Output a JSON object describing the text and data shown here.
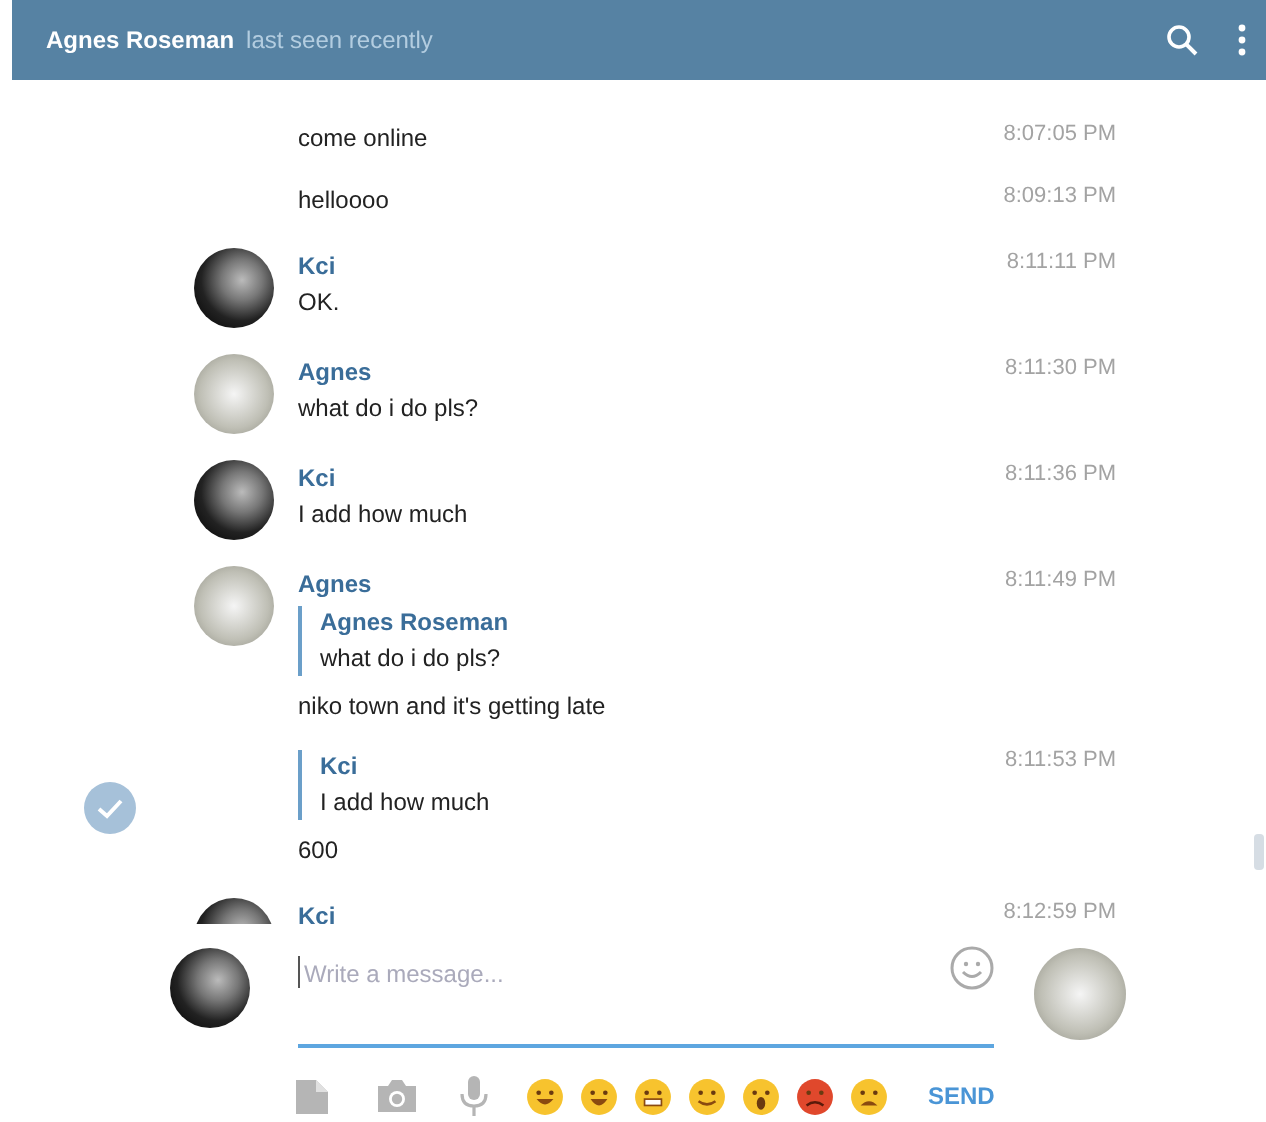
{
  "header": {
    "title": "Agnes Roseman",
    "status": "last seen recently"
  },
  "messages": [
    {
      "kind": "continued",
      "selected": false,
      "text": "come online",
      "time": "8:07:05 PM"
    },
    {
      "kind": "continued",
      "selected": false,
      "text": "helloooo",
      "time": "8:09:13 PM"
    },
    {
      "kind": "named",
      "selected": false,
      "sender": "Kci",
      "avatar": {
        "kind": "dark"
      },
      "text": "OK.",
      "time": "8:11:11 PM"
    },
    {
      "kind": "named",
      "selected": false,
      "sender": "Agnes",
      "avatar": {
        "kind": "light"
      },
      "text": "what do i do pls?",
      "time": "8:11:30 PM"
    },
    {
      "kind": "named",
      "selected": false,
      "sender": "Kci",
      "avatar": {
        "kind": "dark"
      },
      "text": "I add how much",
      "time": "8:11:36 PM"
    },
    {
      "kind": "named",
      "selected": false,
      "sender": "Agnes",
      "avatar": {
        "kind": "light"
      },
      "quote": {
        "name": "Agnes Roseman",
        "text": "what do i do pls?"
      },
      "text": "niko town and it's getting late",
      "time": "8:11:49 PM"
    },
    {
      "kind": "continued",
      "selected": true,
      "quote": {
        "name": "Kci",
        "text": "I add how much"
      },
      "text": "600",
      "time": "8:11:53 PM"
    },
    {
      "kind": "named",
      "selected": false,
      "sender": "Kci",
      "avatar": {
        "kind": "dark"
      },
      "time": "8:12:59 PM"
    }
  ],
  "composer": {
    "placeholder": "Write a message...",
    "send": "SEND"
  }
}
